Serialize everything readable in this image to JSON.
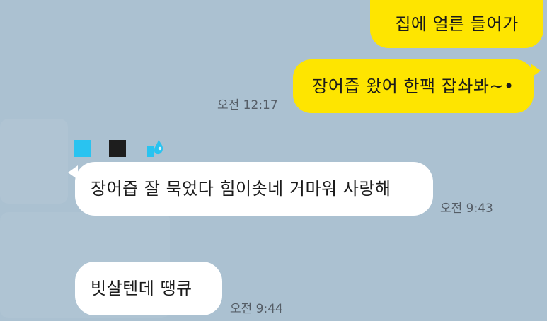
{
  "chat": {
    "background_color": "#abc1d1",
    "outgoing_bubble_color": "#fee500",
    "incoming_bubble_color": "#ffffff",
    "messages": [
      {
        "direction": "outgoing",
        "text": "집에 얼른 들어가",
        "time": ""
      },
      {
        "direction": "outgoing",
        "text": "장어즙 왔어 한팩 잡솨봐~•",
        "time": "오전 12:17"
      },
      {
        "direction": "incoming",
        "text": "장어즙 잘 묵었다 힘이솟네 거마워 사랑해",
        "time": "오전 9:43"
      },
      {
        "direction": "incoming",
        "text": "빗살텐데  땡큐",
        "time": "오전 9:44"
      }
    ],
    "sender_emoji": {
      "icons": [
        "light-blue-square-icon",
        "black-square-icon",
        "water-drop-icon"
      ],
      "colors": [
        "#29c3f0",
        "#1d1d1d",
        "#29c3f0"
      ]
    }
  }
}
